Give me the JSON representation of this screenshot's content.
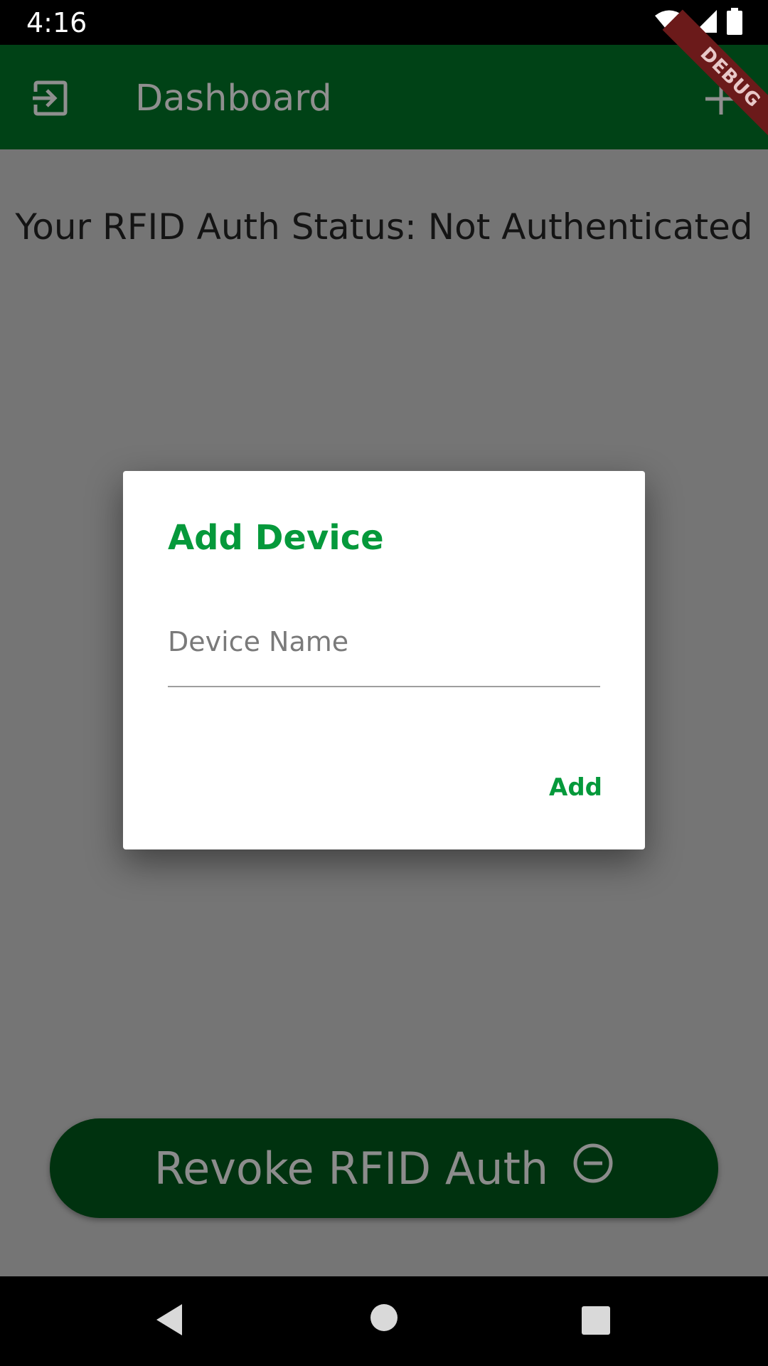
{
  "status_bar": {
    "time": "4:16",
    "icons": [
      "wifi-icon",
      "signal-icon",
      "battery-icon"
    ]
  },
  "debug_banner": {
    "label": "DEBUG",
    "color": "#6b1a1a"
  },
  "app_bar": {
    "title": "Dashboard",
    "leading_icon": "logout-icon",
    "trailing_icon": "plus-icon",
    "background": "#004216"
  },
  "main": {
    "auth_status": "Your RFID Auth Status: Not Authenticated",
    "revoke_button": {
      "label": "Revoke RFID Auth",
      "icon": "minus-circle-icon"
    }
  },
  "dialog": {
    "title": "Add Device",
    "device_name_field": {
      "value": "",
      "placeholder": "Device Name"
    },
    "add_button_label": "Add",
    "accent_color": "#05993b"
  },
  "nav_bar": {
    "buttons": [
      "back-icon",
      "home-icon",
      "recents-icon"
    ]
  }
}
